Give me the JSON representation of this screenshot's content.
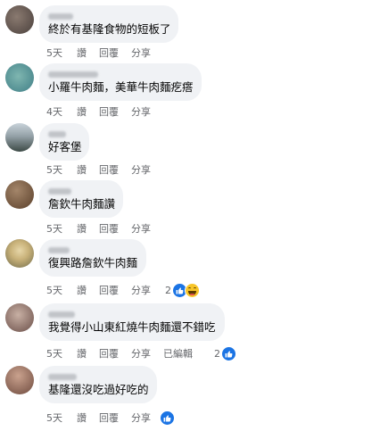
{
  "comments": [
    {
      "text": "終於有基隆食物的短板了",
      "time": "5天",
      "reply": "讚",
      "reply2": "回覆",
      "share": "分享"
    },
    {
      "text": "小羅牛肉麵，美華牛肉麵疙瘩",
      "time": "4天",
      "reply": "讚",
      "reply2": "回覆",
      "share": "分享"
    },
    {
      "text": "好客堡",
      "time": "5天",
      "reply": "讚",
      "reply2": "回覆",
      "share": "分享"
    },
    {
      "text": "詹欽牛肉麵讚",
      "time": "5天",
      "reply": "讚",
      "reply2": "回覆",
      "share": "分享"
    },
    {
      "text": "復興路詹欽牛肉麵",
      "time": "5天",
      "reply": "讚",
      "reply2": "回覆",
      "share": "分享",
      "reaction_count": "2",
      "reactions": [
        "like-icon",
        "haha-icon"
      ]
    },
    {
      "text": "我覺得小山東紅燒牛肉麵還不錯吃",
      "time": "5天",
      "reply": "讚",
      "reply2": "回覆",
      "share": "分享",
      "edited": "已編輯",
      "reaction_count": "2",
      "reactions": [
        "like-icon"
      ]
    },
    {
      "text": "基隆還沒吃過好吃的",
      "time": "5天",
      "reply": "讚",
      "reply2": "回覆",
      "share": "分享",
      "reactions": [
        "like-icon"
      ]
    }
  ],
  "colors": {
    "bubble": "#f0f2f5",
    "meta_text": "#65676b",
    "like": "#1b74e4",
    "haha": "#f7c529"
  }
}
